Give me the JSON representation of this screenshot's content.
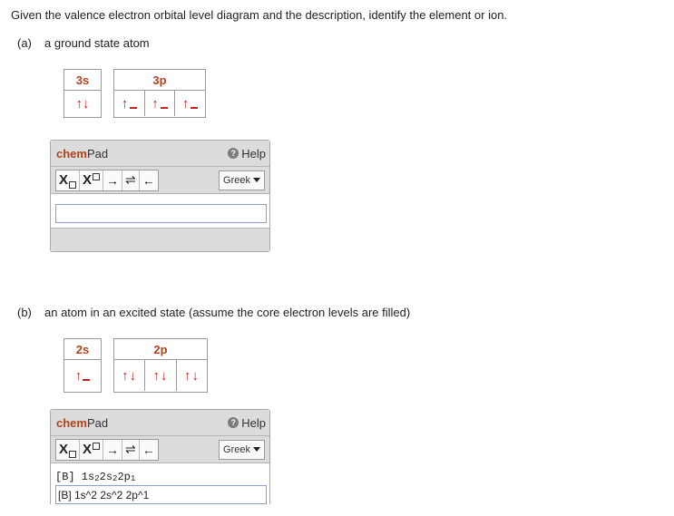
{
  "question": "Given the valence electron orbital level diagram and the description, identify the element or ion.",
  "part_a": {
    "letter": "(a)",
    "description": "a ground state atom",
    "s_label": "3s",
    "p_label": "3p",
    "s_box": "↑↓",
    "p_boxes": [
      "↑",
      "↑",
      "↑"
    ]
  },
  "part_b": {
    "letter": "(b)",
    "description": "an atom in an excited state (assume the core electron levels are filled)",
    "s_label": "2s",
    "p_label": "2p",
    "s_box": "↑",
    "p_boxes": [
      "↑↓",
      "↑↓",
      "↑↓"
    ]
  },
  "chempad": {
    "title_bold": "chem",
    "title_rest": "Pad",
    "help_icon_glyph": "?",
    "help": "Help",
    "greek": "Greek",
    "tools": {
      "subscript": "X",
      "superscript": "X",
      "arrow": "→",
      "equilibrium": "⇌",
      "left_arrow": "←"
    }
  },
  "answer_a": {
    "value": "",
    "preview": ""
  },
  "answer_b": {
    "value": "[B] 1s^2 2s^2 2p^1",
    "preview_prefix": "[B] 1s",
    "preview_sup1": "2",
    "preview_mid1": " 2s",
    "preview_sup2": "2",
    "preview_mid2": " 2p",
    "preview_sup3": "1"
  }
}
